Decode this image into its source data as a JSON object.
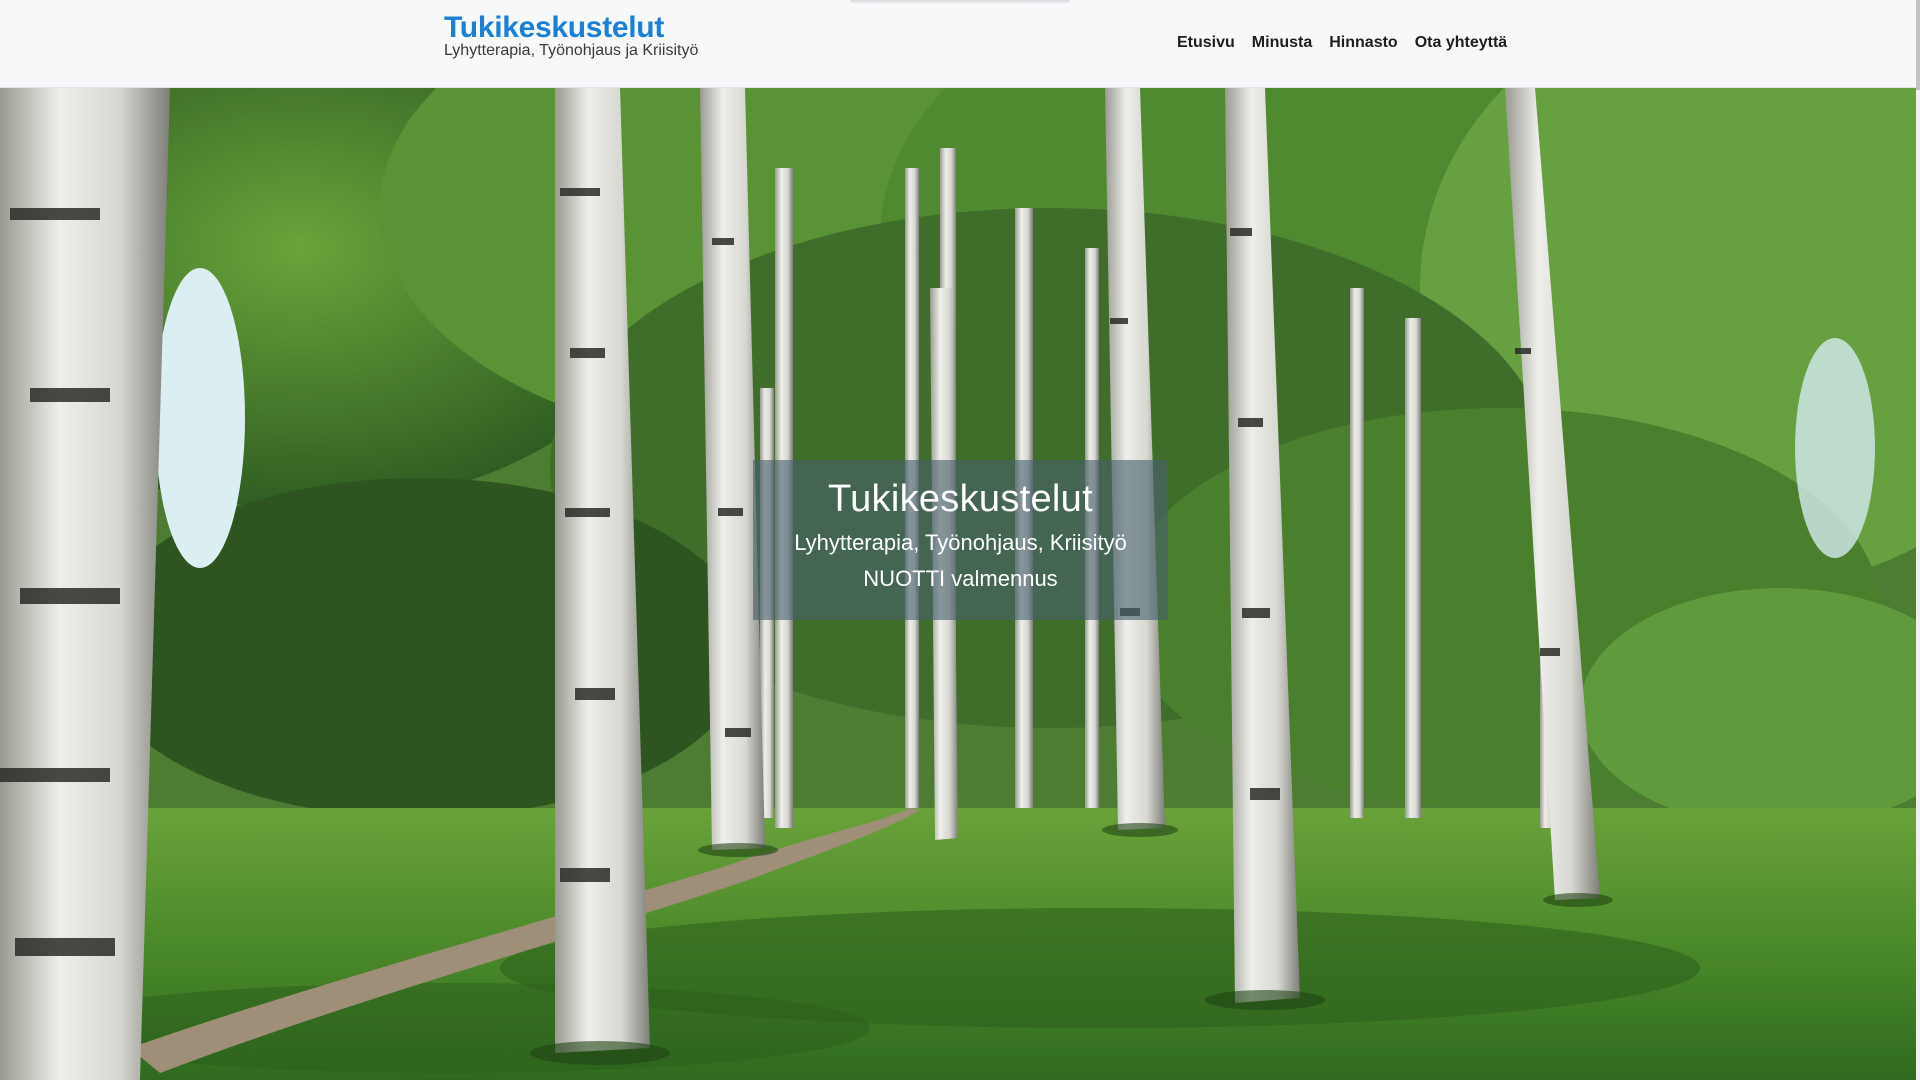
{
  "header": {
    "brand_title": "Tukikeskustelut",
    "brand_subtitle": "Lyhytterapia, Työnohjaus ja Kriisityö",
    "nav": [
      {
        "label": "Etusivu"
      },
      {
        "label": "Minusta"
      },
      {
        "label": "Hinnasto"
      },
      {
        "label": "Ota yhteyttä"
      }
    ]
  },
  "hero": {
    "image": "birch-forest-park",
    "title": "Tukikeskustelut",
    "line1": "Lyhytterapia, Työnohjaus, Kriisityö",
    "line2": "NUOTTI valmennus"
  },
  "colors": {
    "brand": "#1b7fd6",
    "header_bg": "#f7f8fa",
    "overlay": "#465f69"
  }
}
